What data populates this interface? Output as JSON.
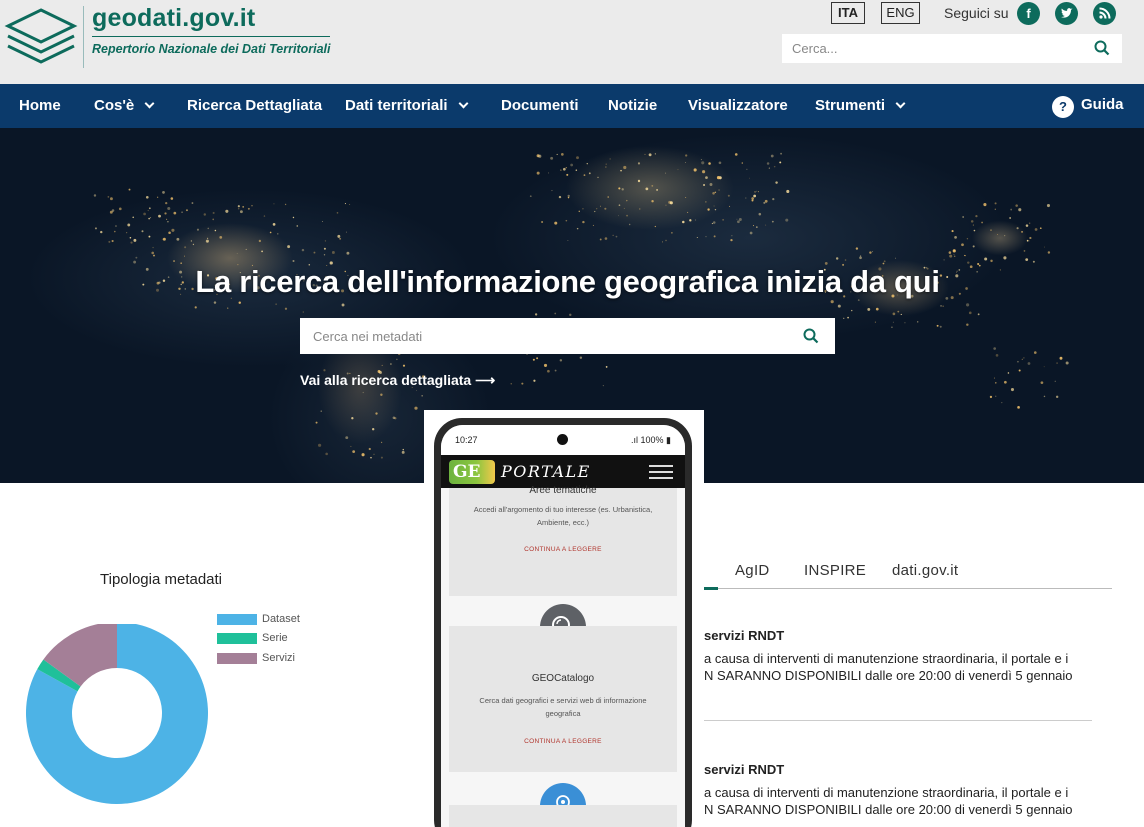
{
  "header": {
    "site_title": "geodati.gov.it",
    "site_subtitle": "Repertorio Nazionale dei Dati Territoriali",
    "lang_ita": "ITA",
    "lang_eng": "ENG",
    "follow_label": "Seguici su",
    "social": [
      "facebook-icon",
      "twitter-icon",
      "rss-icon"
    ],
    "search_placeholder": "Cerca...",
    "brand_color": "#0d6b5c"
  },
  "nav": {
    "items": [
      {
        "label": "Home",
        "dropdown": false
      },
      {
        "label": "Cos'è",
        "dropdown": true
      },
      {
        "label": "Ricerca Dettagliata",
        "dropdown": false
      },
      {
        "label": "Dati territoriali",
        "dropdown": true
      },
      {
        "label": "Documenti",
        "dropdown": false
      },
      {
        "label": "Notizie",
        "dropdown": false
      },
      {
        "label": "Visualizzatore",
        "dropdown": false
      },
      {
        "label": "Strumenti",
        "dropdown": true
      }
    ],
    "guida_label": "Guida",
    "bg_color": "#0b3a6b"
  },
  "hero": {
    "title": "La ricerca dell'informazione geografica inizia da qui",
    "search_placeholder": "Cerca nei metadati",
    "detail_link": "Vai alla ricerca dettagliata ⟶"
  },
  "metadata_chart": {
    "title": "Tipologia metadati",
    "legend": [
      {
        "label": "Dataset",
        "color": "#4db3e6"
      },
      {
        "label": "Serie",
        "color": "#1fc09a"
      },
      {
        "label": "Servizi",
        "color": "#a47f97"
      }
    ]
  },
  "chart_data": {
    "type": "pie",
    "title": "Tipologia metadati",
    "categories": [
      "Dataset",
      "Serie",
      "Servizi"
    ],
    "values": [
      83,
      2,
      15
    ],
    "colors": [
      "#4db3e6",
      "#1fc09a",
      "#a47f97"
    ],
    "legend": "right"
  },
  "news": {
    "tabs": [
      "AgID",
      "INSPIRE",
      "dati.gov.it"
    ],
    "items": [
      {
        "title": "servizi RNDT",
        "line1": "a causa di interventi di manutenzione straordinaria, il portale e i",
        "line2": "N SARANNO DISPONIBILI dalle ore 20:00 di venerdì 5 gennaio"
      },
      {
        "title": "servizi RNDT",
        "line1": "a causa di interventi di manutenzione straordinaria, il portale e i",
        "line2": "N SARANNO DISPONIBILI dalle ore 20:00 di venerdì 5 gennaio"
      }
    ]
  },
  "phone": {
    "time": "10:27",
    "battery": "100%",
    "app_logo": "GE",
    "app_name": "PORTALE",
    "cards": [
      {
        "title": "Aree tematiche",
        "desc": "Accedi all'argomento di tuo interesse (es. Urbanistica, Ambiente, ecc.)",
        "link": "CONTINUA A LEGGERE"
      },
      {
        "title": "GEOCatalogo",
        "desc": "Cerca dati geografici e servizi web di informazione geografica",
        "link": "CONTINUA A LEGGERE"
      }
    ]
  }
}
